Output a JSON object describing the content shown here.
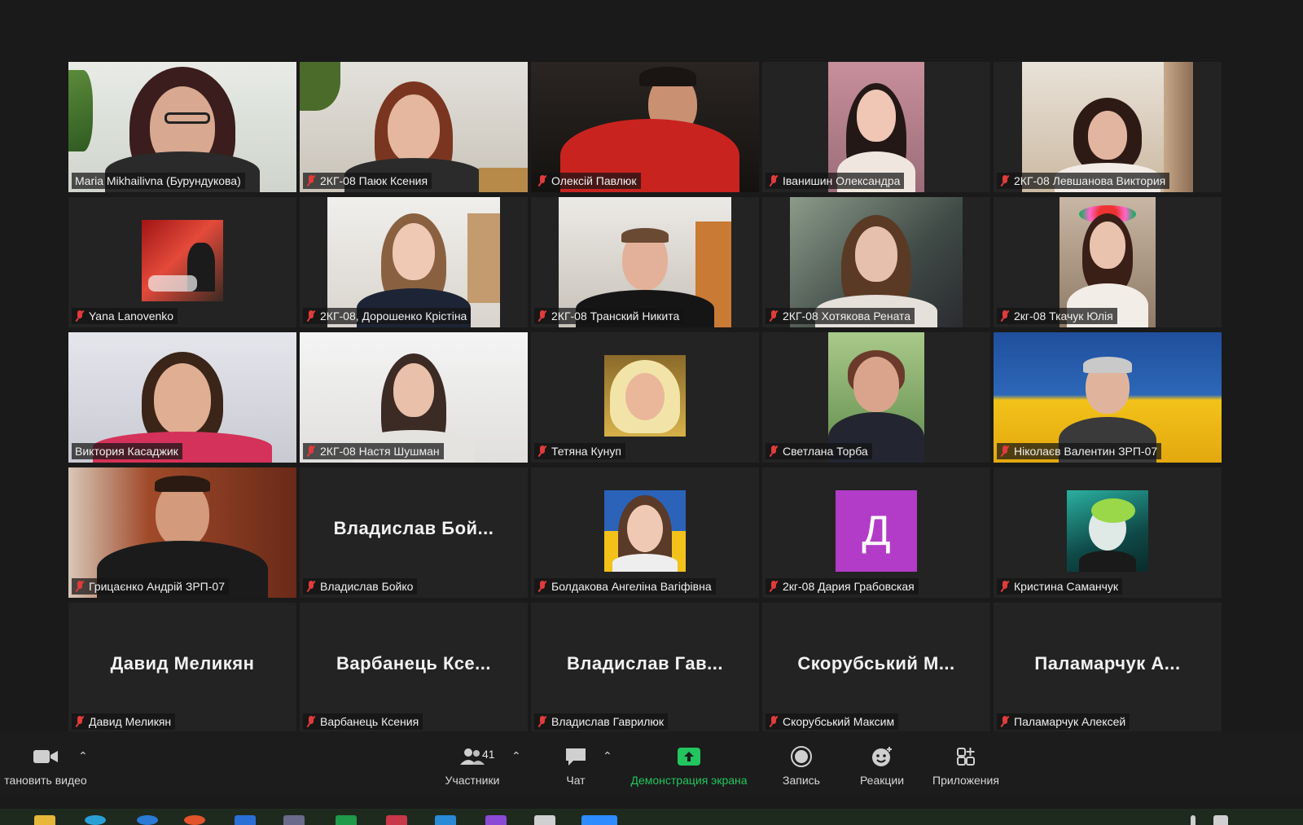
{
  "participants": [
    {
      "name": "Maria Mikhailivna (Бурундукова)",
      "muted": false,
      "active": true
    },
    {
      "name": "2КГ-08 Паюк Ксения",
      "muted": true
    },
    {
      "name": "Олексій Павлюк",
      "muted": true
    },
    {
      "name": "Іванишин Олександра",
      "muted": true
    },
    {
      "name": "2КГ-08 Левшанова Виктория",
      "muted": true
    },
    {
      "name": "Yana Lanovenko",
      "muted": true
    },
    {
      "name": "2КГ-08, Дорошенко Крістіна",
      "muted": true
    },
    {
      "name": "2КГ-08 Транский Никита",
      "muted": true
    },
    {
      "name": "2КГ-08 Хотякова Рената",
      "muted": true
    },
    {
      "name": "2кг-08 Ткачук Юлія",
      "muted": true
    },
    {
      "name": "Виктория Касаджик",
      "muted": false
    },
    {
      "name": "2КГ-08 Настя Шушман",
      "muted": true
    },
    {
      "name": "Тетяна Кунуп",
      "muted": true
    },
    {
      "name": "Светлана Торба",
      "muted": true
    },
    {
      "name": "Ніколаєв Валентин ЗРП-07",
      "muted": true
    },
    {
      "name": "Грицаєнко Андрій ЗРП-07",
      "muted": true
    },
    {
      "name": "Владислав Бойко",
      "muted": true,
      "display": "Владислав  Бой..."
    },
    {
      "name": "Болдакова Ангеліна Вагіфівна",
      "muted": true
    },
    {
      "name": "2кг-08 Дария Грабовская",
      "muted": true,
      "initial": "Д"
    },
    {
      "name": "Кристина Саманчук",
      "muted": true
    },
    {
      "name": "Давид Меликян",
      "muted": true,
      "display": "Давид Меликян"
    },
    {
      "name": "Варбанець Ксения",
      "muted": true,
      "display": "Варбанець  Ксе..."
    },
    {
      "name": "Владислав Гаврилюк",
      "muted": true,
      "display": "Владислав  Гав..."
    },
    {
      "name": "Скорубський Максим",
      "muted": true,
      "display": "Скорубський  М..."
    },
    {
      "name": "Паламарчук Алексей",
      "muted": true,
      "display": "Паламарчук  А..."
    }
  ],
  "toolbar": {
    "video_label": "тановить видео",
    "participants_label": "Участники",
    "participants_count": "41",
    "chat_label": "Чат",
    "share_label": "Демонстрация экрана",
    "record_label": "Запись",
    "reactions_label": "Реакции",
    "apps_label": "Приложения"
  },
  "colors": {
    "active_speaker": "#c6e94c",
    "share_green": "#22c55e",
    "muted_red": "#e13b3b",
    "letter_avatar": "#b23cc8"
  }
}
